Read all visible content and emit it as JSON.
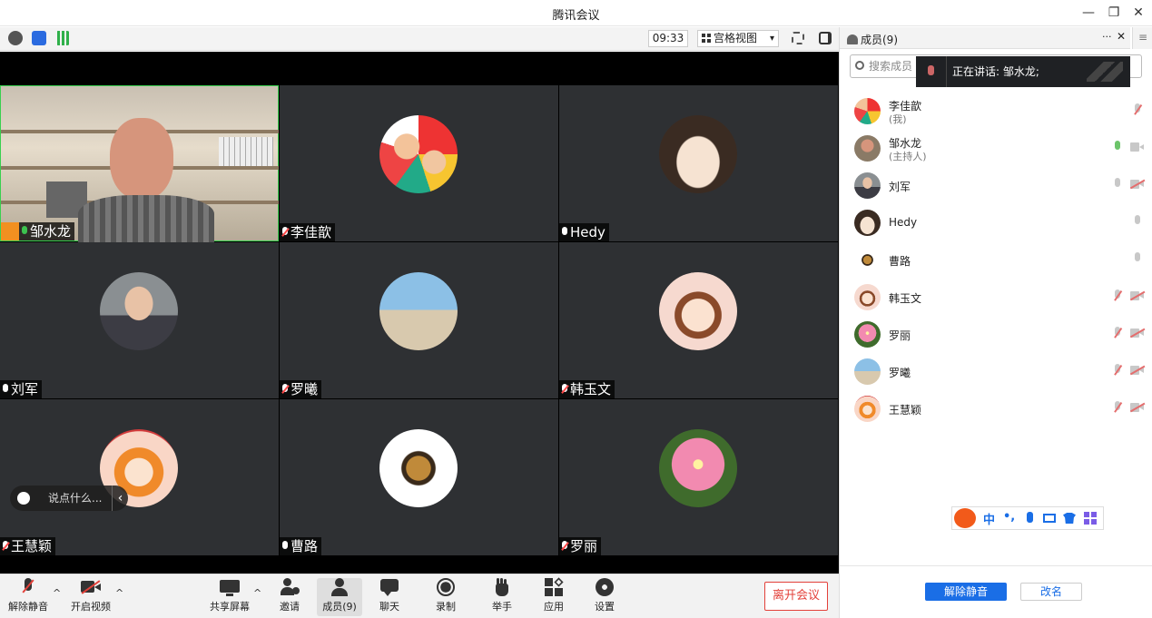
{
  "window": {
    "title": "腾讯会议",
    "min": "—",
    "restore": "❐",
    "close": "✕"
  },
  "topbar": {
    "time": "09:33",
    "view_label": "宫格视图",
    "view_caret": "▾"
  },
  "colors": {
    "accent": "#1a6ee6",
    "leave": "#e3413a",
    "active_speaker": "#39d04f"
  },
  "tiles": [
    {
      "name": "邹水龙",
      "mic": "green"
    },
    {
      "name": "李佳歆",
      "mic": "muted"
    },
    {
      "name": "Hedy",
      "mic": "on"
    },
    {
      "name": "刘军",
      "mic": "on"
    },
    {
      "name": "罗曦",
      "mic": "muted"
    },
    {
      "name": "韩玉文",
      "mic": "muted"
    },
    {
      "name": "王慧颖",
      "mic": "muted"
    },
    {
      "name": "曹路",
      "mic": "on"
    },
    {
      "name": "罗丽",
      "mic": "muted"
    }
  ],
  "chat": {
    "placeholder": "说点什么...",
    "collapse": "‹"
  },
  "bottombar": {
    "unmute": "解除静音",
    "start_video": "开启视频",
    "share": "共享屏幕",
    "invite": "邀请",
    "members": "成员(9)",
    "chat": "聊天",
    "record": "录制",
    "raise_hand": "举手",
    "apps": "应用",
    "settings": "设置",
    "leave": "离开会议",
    "caret": "^"
  },
  "panel": {
    "title": "成员(9)",
    "more": "···",
    "close": "✕",
    "side": "≡",
    "search_placeholder": "搜索成员",
    "speaking_label": "正在讲话: 邹水龙;",
    "members": [
      {
        "name": "李佳歆",
        "sub": "(我)",
        "mic": "off",
        "cam": "none"
      },
      {
        "name": "邹水龙",
        "sub": "(主持人)",
        "mic": "on",
        "cam": "on"
      },
      {
        "name": "刘军",
        "sub": "",
        "mic": "idle",
        "cam": "off"
      },
      {
        "name": "Hedy",
        "sub": "",
        "mic": "idle",
        "cam": "none"
      },
      {
        "name": "曹路",
        "sub": "",
        "mic": "idle",
        "cam": "none"
      },
      {
        "name": "韩玉文",
        "sub": "",
        "mic": "off",
        "cam": "off"
      },
      {
        "name": "罗丽",
        "sub": "",
        "mic": "off",
        "cam": "off"
      },
      {
        "name": "罗曦",
        "sub": "",
        "mic": "off",
        "cam": "off"
      },
      {
        "name": "王慧颖",
        "sub": "",
        "mic": "off",
        "cam": "off"
      }
    ],
    "ime": {
      "lang": "中",
      "punct": "•,"
    },
    "unmute_btn": "解除静音",
    "rename_btn": "改名"
  }
}
